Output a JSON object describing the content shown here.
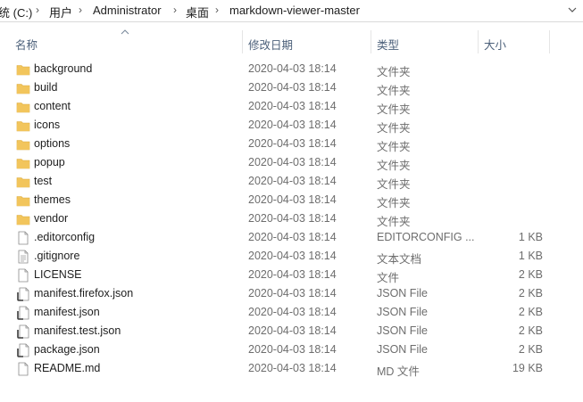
{
  "breadcrumb": {
    "items": [
      "统 (C:)",
      "用户",
      "Administrator",
      "桌面",
      "markdown-viewer-master"
    ]
  },
  "columns": {
    "name": "名称",
    "date": "修改日期",
    "type": "类型",
    "size": "大小"
  },
  "colors": {
    "folder": "#f2c55c",
    "folder_dark": "#dcaa3a",
    "header_text": "#4c607a"
  },
  "files": [
    {
      "name": "background",
      "date": "2020-04-03 18:14",
      "type": "文件夹",
      "size": "",
      "icon": "folder-icon"
    },
    {
      "name": "build",
      "date": "2020-04-03 18:14",
      "type": "文件夹",
      "size": "",
      "icon": "folder-icon"
    },
    {
      "name": "content",
      "date": "2020-04-03 18:14",
      "type": "文件夹",
      "size": "",
      "icon": "folder-icon"
    },
    {
      "name": "icons",
      "date": "2020-04-03 18:14",
      "type": "文件夹",
      "size": "",
      "icon": "folder-icon"
    },
    {
      "name": "options",
      "date": "2020-04-03 18:14",
      "type": "文件夹",
      "size": "",
      "icon": "folder-icon"
    },
    {
      "name": "popup",
      "date": "2020-04-03 18:14",
      "type": "文件夹",
      "size": "",
      "icon": "folder-icon"
    },
    {
      "name": "test",
      "date": "2020-04-03 18:14",
      "type": "文件夹",
      "size": "",
      "icon": "folder-icon"
    },
    {
      "name": "themes",
      "date": "2020-04-03 18:14",
      "type": "文件夹",
      "size": "",
      "icon": "folder-icon"
    },
    {
      "name": "vendor",
      "date": "2020-04-03 18:14",
      "type": "文件夹",
      "size": "",
      "icon": "folder-icon"
    },
    {
      "name": ".editorconfig",
      "date": "2020-04-03 18:14",
      "type": "EDITORCONFIG ...",
      "size": "1 KB",
      "icon": "file-icon"
    },
    {
      "name": ".gitignore",
      "date": "2020-04-03 18:14",
      "type": "文本文档",
      "size": "1 KB",
      "icon": "text-file-icon"
    },
    {
      "name": "LICENSE",
      "date": "2020-04-03 18:14",
      "type": "文件",
      "size": "2 KB",
      "icon": "file-icon"
    },
    {
      "name": "manifest.firefox.json",
      "date": "2020-04-03 18:14",
      "type": "JSON File",
      "size": "2 KB",
      "icon": "json-file-icon"
    },
    {
      "name": "manifest.json",
      "date": "2020-04-03 18:14",
      "type": "JSON File",
      "size": "2 KB",
      "icon": "json-file-icon"
    },
    {
      "name": "manifest.test.json",
      "date": "2020-04-03 18:14",
      "type": "JSON File",
      "size": "2 KB",
      "icon": "json-file-icon"
    },
    {
      "name": "package.json",
      "date": "2020-04-03 18:14",
      "type": "JSON File",
      "size": "2 KB",
      "icon": "json-file-icon"
    },
    {
      "name": "README.md",
      "date": "2020-04-03 18:14",
      "type": "MD 文件",
      "size": "19 KB",
      "icon": "file-icon"
    }
  ]
}
